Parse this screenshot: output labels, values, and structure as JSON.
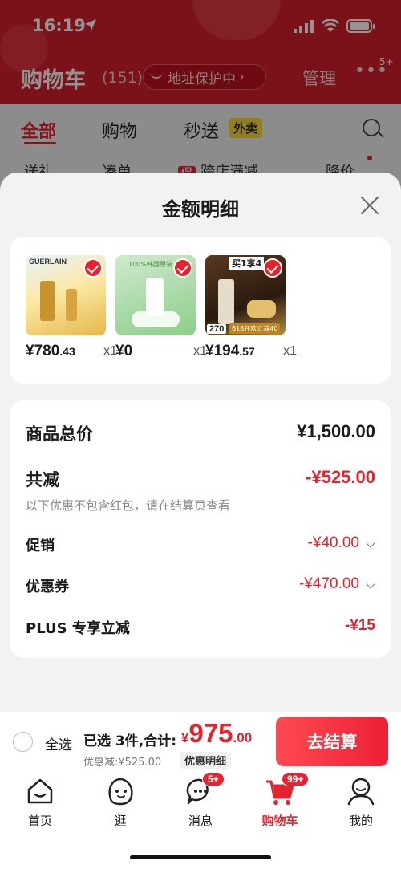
{
  "status": {
    "time": "16:19"
  },
  "header": {
    "title": "购物车",
    "count": "(151)",
    "address_protect": "地址保护中",
    "manage": "管理",
    "more_badge": "5+"
  },
  "tabs": {
    "all": "全部",
    "shopping": "购物",
    "fast": "秒送",
    "waimai": "外卖"
  },
  "filters": {
    "gift": "送礼",
    "coupon": "凑单",
    "cross_tag": "促",
    "cross": "跨店满减",
    "price_drop": "降价"
  },
  "sheet": {
    "title": "金额明细",
    "products": [
      {
        "brand": "GUERLAIN",
        "price_int": "¥780",
        "price_dec": ".43",
        "qty": "x1"
      },
      {
        "note": "100%韩国原装",
        "price_int": "¥0",
        "price_dec": "",
        "qty": "x1"
      },
      {
        "buy_tag": "买1享4",
        "badge": "270",
        "badge_note": "618狂欢立减40",
        "price_int": "¥194",
        "price_dec": ".57",
        "qty": "x1"
      }
    ],
    "summary": {
      "total_label": "商品总价",
      "total_value": "¥1,500.00",
      "reduce_label": "共减",
      "reduce_value": "-¥525.00",
      "note": "以下优惠不包含红包，请在结算页查看",
      "promo_label": "促销",
      "promo_value": "-¥40.00",
      "coupon_label": "优惠券",
      "coupon_value": "-¥470.00",
      "plus_label": "PLUS 专享立减",
      "plus_value": "-¥15"
    }
  },
  "checkout": {
    "select_all": "全选",
    "selected": "已选 3件,合计:",
    "currency": "¥",
    "total_int": "975",
    "total_dec": ".00",
    "discount": "优惠减:¥525.00",
    "detail": "优惠明细",
    "pay": "去结算"
  },
  "tabbar": [
    {
      "label": "首页",
      "icon": "home-icon"
    },
    {
      "label": "逛",
      "icon": "browse-face-icon"
    },
    {
      "label": "消息",
      "icon": "message-icon",
      "badge": "5+"
    },
    {
      "label": "购物车",
      "icon": "cart-icon",
      "badge": "99+"
    },
    {
      "label": "我的",
      "icon": "profile-icon"
    }
  ],
  "colors": {
    "accent": "#e4232f",
    "header_bg": "#d51e2b"
  }
}
